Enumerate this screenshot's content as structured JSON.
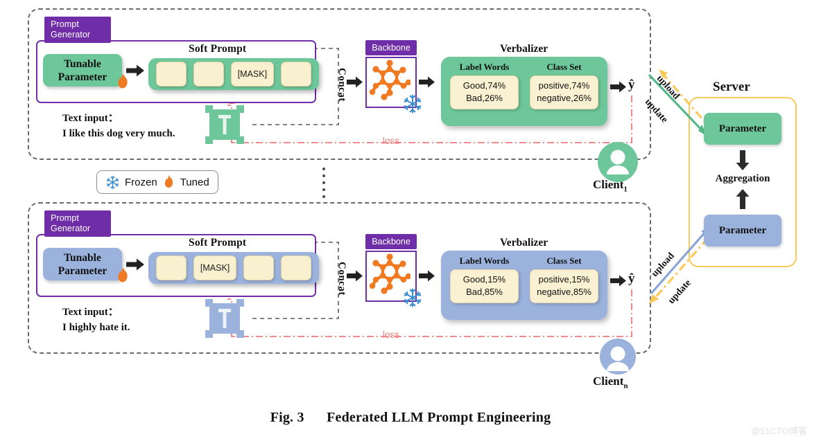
{
  "figure": {
    "caption_prefix": "Fig. 3",
    "caption_title": "Federated LLM Prompt Engineering",
    "watermark": "@51CTO博客"
  },
  "legend": {
    "frozen_label": "Frozen",
    "tuned_label": "Tuned",
    "frozen_icon": "snowflake-icon",
    "tuned_icon": "flame-icon",
    "frozen_color": "#3a8fd0",
    "tuned_color": "#ef7a22"
  },
  "palette": {
    "purple": "#6f2da8",
    "green": "#6ec79a",
    "blue": "#9bb2dd",
    "cream": "#faf1d2",
    "yellow": "#fbc95b",
    "loss_red": "#ef7b7b",
    "dashed_gray": "#6b6b6b",
    "orange": "#ef7a22"
  },
  "clients": [
    {
      "id": "client-1",
      "label": "Client",
      "sub": "1",
      "accent": "#6ec79a",
      "prompt_generator": {
        "tab_line1": "Prompt",
        "tab_line2": "Generator",
        "tunable_label": "Tunable\nParameter",
        "tunable_line1": "Tunable",
        "tunable_line2": "Parameter",
        "tuned_icon": "flame-icon",
        "soft_prompt_title": "Soft Prompt",
        "soft_prompt_cells": [
          "",
          "",
          "[MASK]",
          ""
        ],
        "mask_index": 2,
        "text_input_label": "Text input：",
        "text_input_value": "I like this dog very much.",
        "text_icon": "text-T-icon"
      },
      "concat_label": "Concat",
      "backbone": {
        "tab_label": "Backbone",
        "graph_icon": "molecule-graph-icon",
        "frozen_icon": "snowflake-icon"
      },
      "verbalizer": {
        "title": "Verbalizer",
        "columns": [
          {
            "header": "Label Words",
            "rows": [
              "Good,74%",
              "Bad,26%"
            ]
          },
          {
            "header": "Class Set",
            "rows": [
              "positive,74%",
              "negative,26%"
            ]
          }
        ]
      },
      "output_label": "ŷ",
      "loss_label": "loss",
      "upload_label": "upload",
      "update_label": "update"
    },
    {
      "id": "client-n",
      "label": "Client",
      "sub": "n",
      "accent": "#9bb2dd",
      "prompt_generator": {
        "tab_line1": "Prompt",
        "tab_line2": "Generator",
        "tunable_line1": "Tunable",
        "tunable_line2": "Parameter",
        "tuned_icon": "flame-icon",
        "soft_prompt_title": "Soft Prompt",
        "soft_prompt_cells": [
          "",
          "[MASK]",
          "",
          ""
        ],
        "mask_index": 1,
        "text_input_label": "Text input：",
        "text_input_value": "I highly hate it.",
        "text_icon": "text-T-icon"
      },
      "concat_label": "Concat",
      "backbone": {
        "tab_label": "Backbone",
        "graph_icon": "molecule-graph-icon",
        "frozen_icon": "snowflake-icon"
      },
      "verbalizer": {
        "title": "Verbalizer",
        "columns": [
          {
            "header": "Label Words",
            "rows": [
              "Good,15%",
              "Bad,85%"
            ]
          },
          {
            "header": "Class Set",
            "rows": [
              "positive,15%",
              "negative,85%"
            ]
          }
        ]
      },
      "output_label": "ŷ",
      "loss_label": "loss",
      "upload_label": "upload",
      "update_label": "update"
    }
  ],
  "server": {
    "title": "Server",
    "parameter_top_label": "Parameter",
    "parameter_bottom_label": "Parameter",
    "aggregation_label": "Aggregation",
    "parameter_top_color": "#6ec79a",
    "parameter_bottom_color": "#9bb2dd"
  }
}
